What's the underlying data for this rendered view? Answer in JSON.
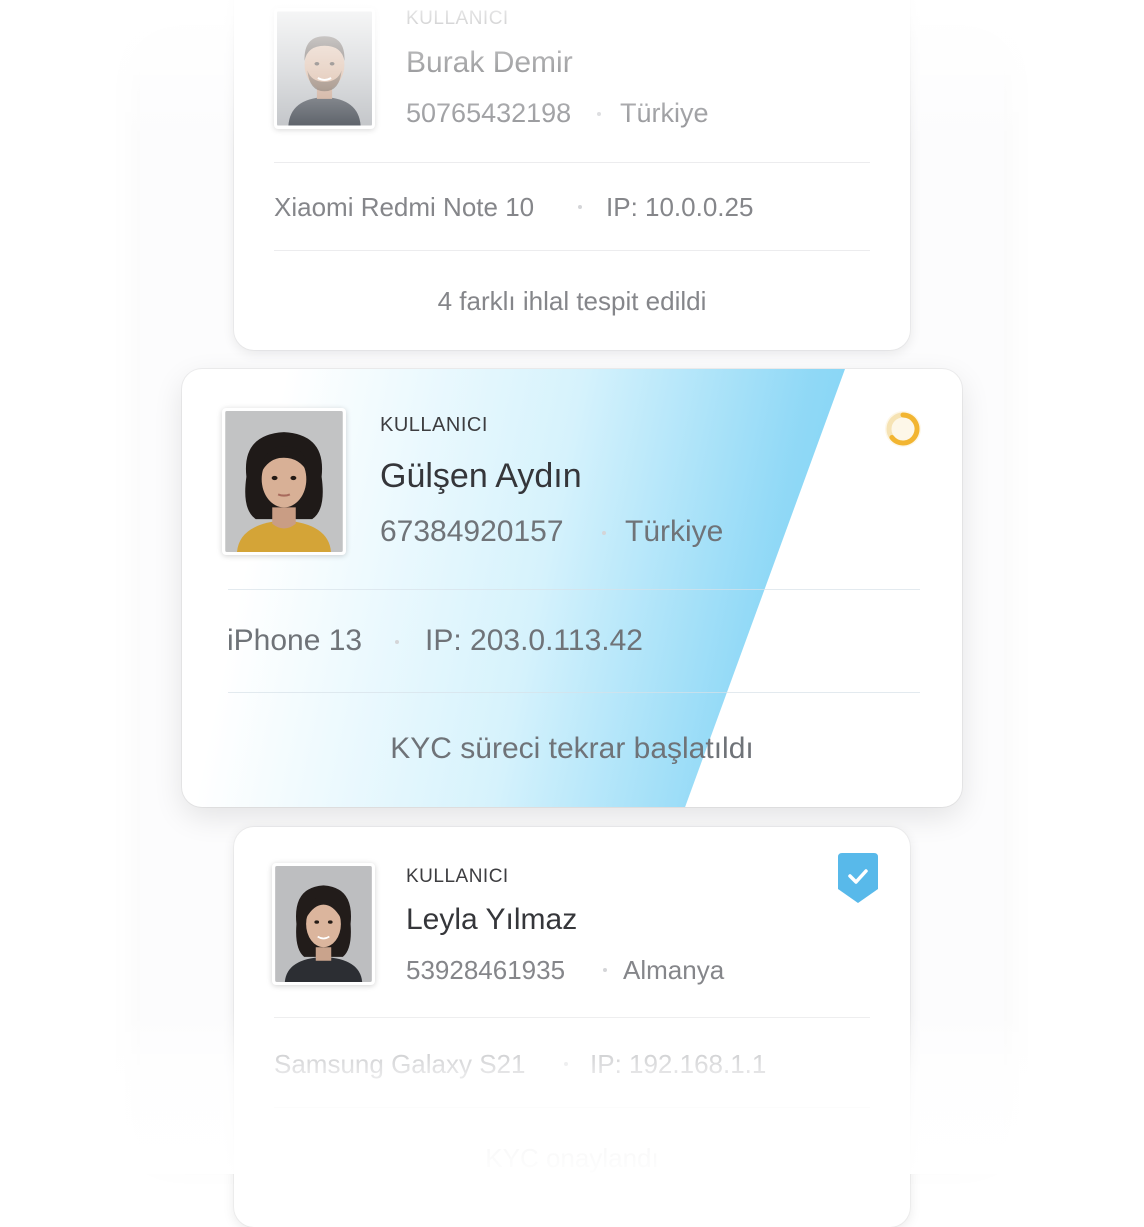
{
  "colors": {
    "accent_blue": "#58b9ea",
    "pending_yellow": "#f2b531",
    "text_dark": "#35363a",
    "text_muted": "#85868a"
  },
  "cards": [
    {
      "role_label": "KULLANICI",
      "name": "Burak Demir",
      "id_number": "50765432198",
      "country": "Türkiye",
      "device": "Xiaomi Redmi Note 10",
      "ip": "IP: 10.0.0.25",
      "status": "4 farklı ihlal tespit edildi",
      "avatar_icon": "male-portrait-photo"
    },
    {
      "role_label": "KULLANICI",
      "name": "Gülşen Aydın",
      "id_number": "67384920157",
      "country": "Türkiye",
      "device": "iPhone 13",
      "ip": "IP: 203.0.113.42",
      "status": "KYC süreci tekrar başlatıldı",
      "avatar_icon": "female-portrait-photo",
      "status_icon": "loading-spinner-icon"
    },
    {
      "role_label": "KULLANICI",
      "name": "Leyla Yılmaz",
      "id_number": "53928461935",
      "country": "Almanya",
      "device": "Samsung Galaxy S21",
      "ip": "IP: 192.168.1.1",
      "status": "KYC onaylandı",
      "avatar_icon": "female-portrait-photo",
      "status_icon": "verified-shield-icon"
    }
  ]
}
